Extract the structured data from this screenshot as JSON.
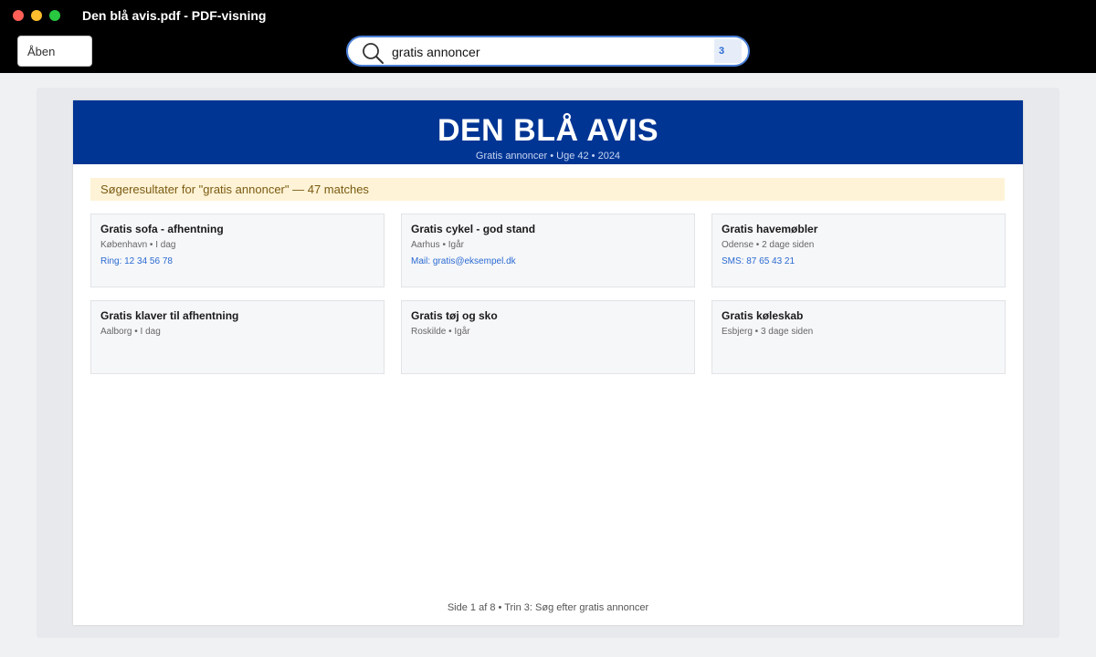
{
  "window": {
    "title": "Den blå avis.pdf - PDF-visning"
  },
  "toolbar": {
    "open_label": "Åben",
    "search": {
      "value": "gratis annoncer",
      "match_count": "3"
    }
  },
  "document": {
    "masthead_title": "DEN BLÅ AVIS",
    "masthead_subtitle": "Gratis annoncer • Uge 42 • 2024",
    "results_banner": "Søgeresultater for \"gratis annoncer\" — 47 matches",
    "ads": [
      {
        "title": "Gratis sofa - afhentning",
        "meta": "København • I dag",
        "contact": "Ring: 12 34 56 78"
      },
      {
        "title": "Gratis cykel - god stand",
        "meta": "Aarhus • Igår",
        "contact": "Mail: gratis@eksempel.dk"
      },
      {
        "title": "Gratis havemøbler",
        "meta": "Odense • 2 dage siden",
        "contact": "SMS: 87 65 43 21"
      },
      {
        "title": "Gratis klaver til afhentning",
        "meta": "Aalborg • I dag",
        "contact": ""
      },
      {
        "title": "Gratis tøj og sko",
        "meta": "Roskilde • Igår",
        "contact": ""
      },
      {
        "title": "Gratis køleskab",
        "meta": "Esbjerg • 3 dage siden",
        "contact": ""
      }
    ],
    "footer": "Side 1 af 8 • Trin 3: Søg efter gratis annoncer"
  },
  "colors": {
    "masthead": "#003594",
    "search_border": "#4a7fd6",
    "link": "#2a6ad2",
    "banner_bg": "#fef3d6"
  }
}
